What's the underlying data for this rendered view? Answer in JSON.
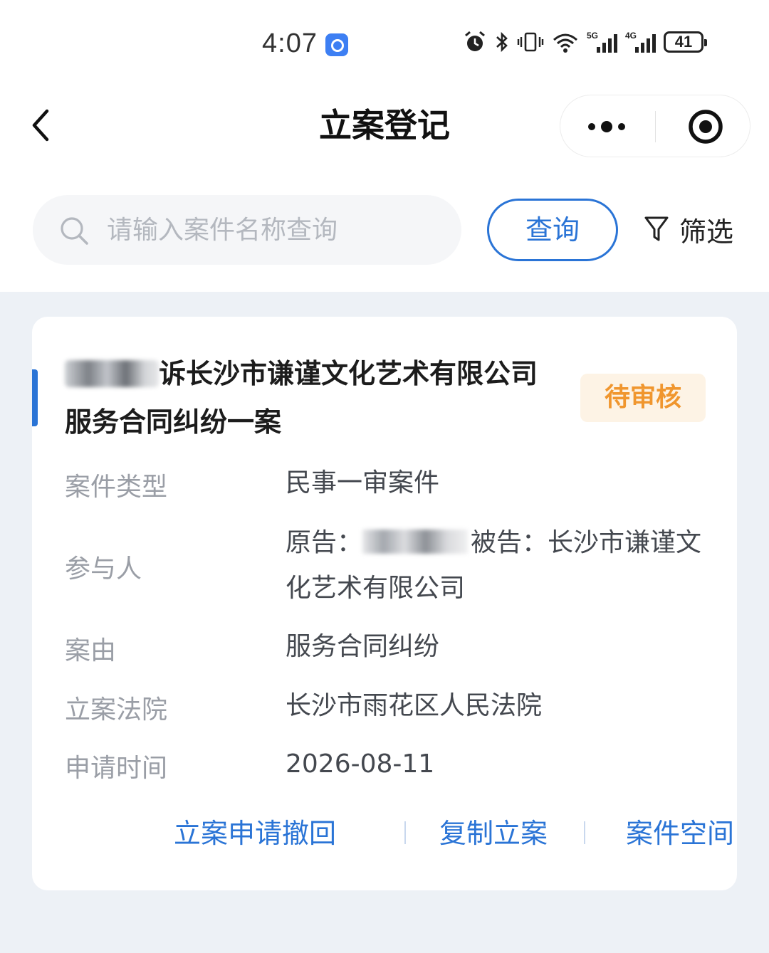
{
  "status_bar": {
    "time": "4:07",
    "battery": "41",
    "network_5g": "5G",
    "network_4g": "4G"
  },
  "nav": {
    "title": "立案登记"
  },
  "search": {
    "placeholder": "请输入案件名称查询",
    "value": "",
    "query_label": "查询",
    "filter_label": "筛选"
  },
  "case": {
    "title_visible": "诉长沙市谦谨文化艺术有限公司服务合同纠纷一案",
    "status": "待审核",
    "fields": [
      {
        "label": "案件类型",
        "value": "民事一审案件"
      },
      {
        "label": "参与人",
        "plaintiff_prefix": "原告：",
        "defendant_label": "被告：",
        "defendant": "长沙市谦谨文化艺术有限公司"
      },
      {
        "label": "案由",
        "value": "服务合同纠纷"
      },
      {
        "label": "立案法院",
        "value": "长沙市雨花区人民法院"
      },
      {
        "label": "申请时间",
        "value": "2026-08-11"
      }
    ],
    "actions": [
      {
        "label": "立案申请撤回"
      },
      {
        "label": "复制立案"
      },
      {
        "label": "案件空间"
      }
    ]
  },
  "colors": {
    "accent": "#2a74d6",
    "status_text": "#f0962e",
    "status_bg": "#fdf3e5",
    "page_bg": "#edf1f6"
  }
}
